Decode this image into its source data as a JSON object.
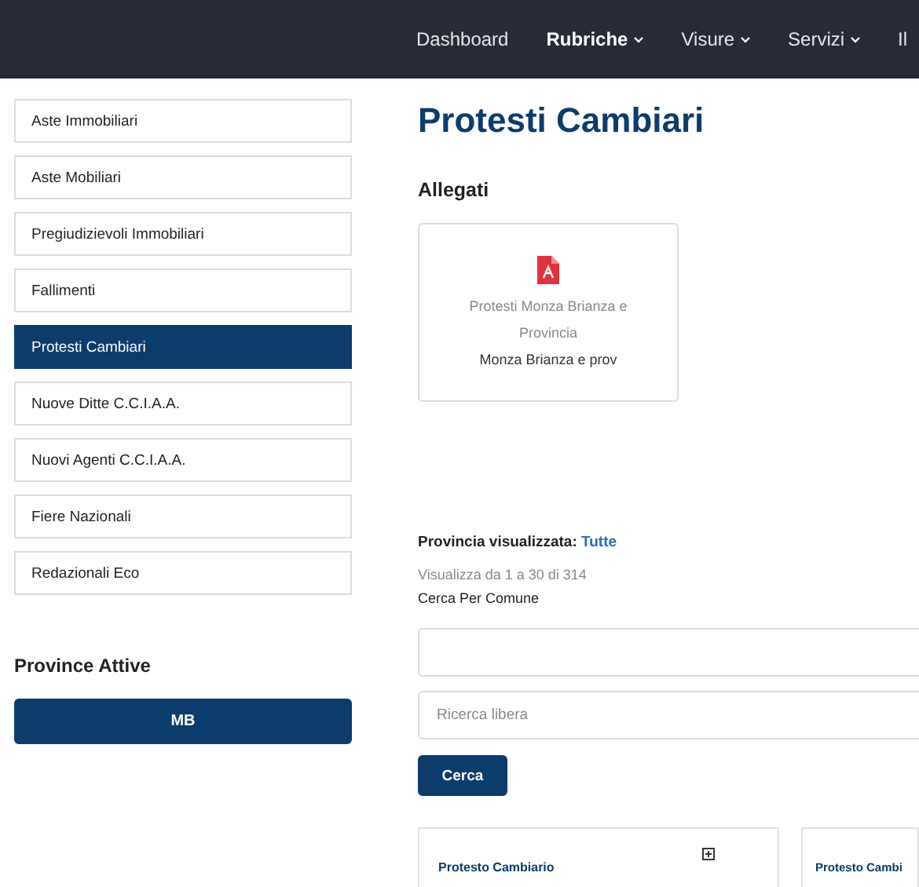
{
  "nav": [
    {
      "label": "Dashboard",
      "bold": false,
      "dropdown": false
    },
    {
      "label": "Rubriche",
      "bold": true,
      "dropdown": true
    },
    {
      "label": "Visure",
      "bold": false,
      "dropdown": true
    },
    {
      "label": "Servizi",
      "bold": false,
      "dropdown": true
    },
    {
      "label": "Il",
      "bold": false,
      "dropdown": false
    }
  ],
  "sidebar": {
    "items": [
      {
        "label": "Aste Immobiliari",
        "selected": false
      },
      {
        "label": "Aste Mobiliari",
        "selected": false
      },
      {
        "label": "Pregiudizievoli Immobiliari",
        "selected": false
      },
      {
        "label": "Fallimenti",
        "selected": false
      },
      {
        "label": "Protesti Cambiari",
        "selected": true
      },
      {
        "label": "Nuove Ditte C.C.I.A.A.",
        "selected": false
      },
      {
        "label": "Nuovi Agenti C.C.I.A.A.",
        "selected": false
      },
      {
        "label": "Fiere Nazionali",
        "selected": false
      },
      {
        "label": "Redazionali Eco",
        "selected": false
      }
    ],
    "province_title": "Province Attive",
    "provinces": [
      "MB"
    ]
  },
  "main": {
    "title": "Protesti Cambiari",
    "attachments_title": "Allegati",
    "attachments": [
      {
        "title": "Protesti Monza Brianza e Provincia",
        "subtitle": "Monza Brianza e prov"
      }
    ],
    "province_label": "Provincia visualizzata:",
    "province_value": "Tutte",
    "count": "Visualizza da 1 a 30 di 314",
    "search_label": "Cerca Per Comune",
    "free_field": {
      "placeholder": "Ricerca libera"
    },
    "search_button": "Cerca",
    "results": [
      {
        "title": "Protesto Cambiario",
        "add_icon": true
      },
      {
        "title": "Protesto Cambi"
      }
    ]
  }
}
